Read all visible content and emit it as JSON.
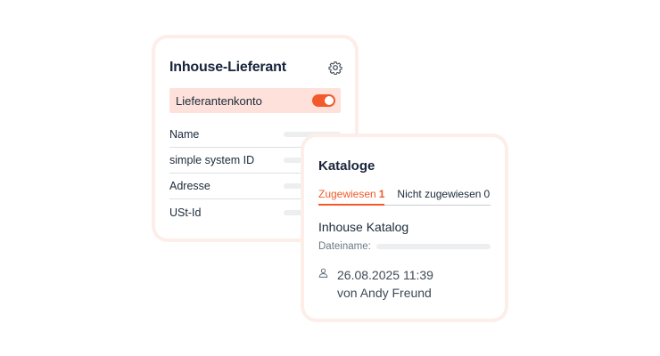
{
  "supplier_card": {
    "title": "Inhouse-Lieferant",
    "settings_icon": "gear-icon",
    "account_toggle": {
      "label": "Lieferantenkonto",
      "enabled": true,
      "color": "#f25a2b"
    },
    "fields": [
      {
        "label": "Name"
      },
      {
        "label": "simple system ID"
      },
      {
        "label": "Adresse"
      },
      {
        "label": "USt-Id"
      }
    ]
  },
  "catalog_card": {
    "title": "Kataloge",
    "tabs": [
      {
        "label": "Zugewiesen",
        "count": "1",
        "active": true
      },
      {
        "label": "Nicht zugewiesen",
        "count": "0",
        "active": false
      }
    ],
    "catalog": {
      "name": "Inhouse Katalog",
      "filename_label": "Dateiname:",
      "date": "26.08.2025 11:39",
      "author": "von Andy Freund",
      "author_icon": "person-icon"
    }
  },
  "colors": {
    "accent": "#f25a2b",
    "card_glow": "#fdeee9",
    "highlight_row": "#fde1da"
  }
}
